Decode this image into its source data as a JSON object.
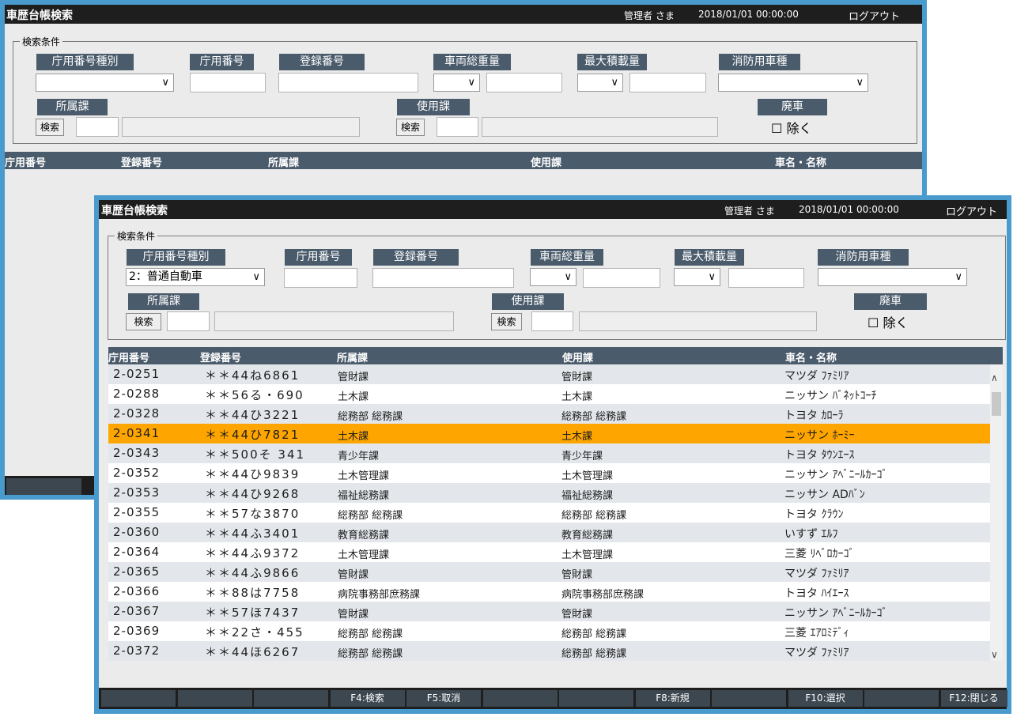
{
  "title": "車歴台帳検索",
  "user": "管理者 さま",
  "datetime": "2018/01/01  00:00:00",
  "logout": "ログアウト",
  "search_group": "検索条件",
  "labels": {
    "agency_type": "庁用番号種別",
    "agency_no": "庁用番号",
    "reg_no": "登録番号",
    "gross_weight": "車両総重量",
    "max_load": "最大積載量",
    "fire_type": "消防用車種",
    "dept": "所属課",
    "user_dept": "使用課",
    "scrap": "廃車",
    "exclude": "除く",
    "search_btn": "検索"
  },
  "back_window": {
    "agency_type_value": ""
  },
  "front_window": {
    "agency_type_value": "2：普通自動車"
  },
  "columns": [
    "庁用番号",
    "登録番号",
    "所属課",
    "使用課",
    "車名・名称"
  ],
  "rows": [
    [
      "2-0251",
      "＊＊44ね6861",
      "管財課",
      "管財課",
      "マツダ ﾌｧﾐﾘｱ"
    ],
    [
      "2-0288",
      "＊＊56る・690",
      "土木課",
      "土木課",
      "ニッサン ﾊﾞﾈｯﾄｺｰﾁ"
    ],
    [
      "2-0328",
      "＊＊44ひ3221",
      "総務部 総務課",
      "総務部 総務課",
      "トヨタ ｶﾛｰﾗ"
    ],
    [
      "2-0341",
      "＊＊44ひ7821",
      "土木課",
      "土木課",
      "ニッサン ﾎｰﾐｰ"
    ],
    [
      "2-0343",
      "＊＊500そ 341",
      "青少年課",
      "青少年課",
      "トヨタ ﾀｳﾝｴｰｽ"
    ],
    [
      "2-0352",
      "＊＊44ひ9839",
      "土木管理課",
      "土木管理課",
      "ニッサン ｱﾍﾞﾆｰﾙｶｰｺﾞ"
    ],
    [
      "2-0353",
      "＊＊44ひ9268",
      "福祉総務課",
      "福祉総務課",
      "ニッサン ADﾊﾞﾝ"
    ],
    [
      "2-0355",
      "＊＊57な3870",
      "総務部 総務課",
      "総務部 総務課",
      "トヨタ ｸﾗｳﾝ"
    ],
    [
      "2-0360",
      "＊＊44ふ3401",
      "教育総務課",
      "教育総務課",
      "いすず ｴﾙﾌ"
    ],
    [
      "2-0364",
      "＊＊44ふ9372",
      "土木管理課",
      "土木管理課",
      "三菱 ﾘﾍﾞﾛｶｰｺﾞ"
    ],
    [
      "2-0365",
      "＊＊44ふ9866",
      "管財課",
      "管財課",
      "マツダ ﾌｧﾐﾘｱ"
    ],
    [
      "2-0366",
      "＊＊88は7758",
      "病院事務部庶務課",
      "病院事務部庶務課",
      "トヨタ ﾊｲｴｰｽ"
    ],
    [
      "2-0367",
      "＊＊57ほ7437",
      "管財課",
      "管財課",
      "ニッサン ｱﾍﾞﾆｰﾙｶｰｺﾞ"
    ],
    [
      "2-0369",
      "＊＊22さ・455",
      "総務部 総務課",
      "総務部 総務課",
      "三菱 ｴｱﾛﾐﾃﾞｨ"
    ],
    [
      "2-0372",
      "＊＊44ほ6267",
      "総務部 総務課",
      "総務部 総務課",
      "マツダ ﾌｧﾐﾘｱ"
    ]
  ],
  "selected_row_index": 3,
  "fkeys": [
    "",
    "",
    "",
    "F4:検索",
    "F5:取消",
    "",
    "",
    "F8:新規",
    "",
    "F10:選択",
    "",
    "F12:閉じる"
  ],
  "colors": {
    "frame": "#4a9bcd",
    "header": "#4a5b6b",
    "selected": "#ffa500",
    "titlebar": "#1e1e1e"
  }
}
